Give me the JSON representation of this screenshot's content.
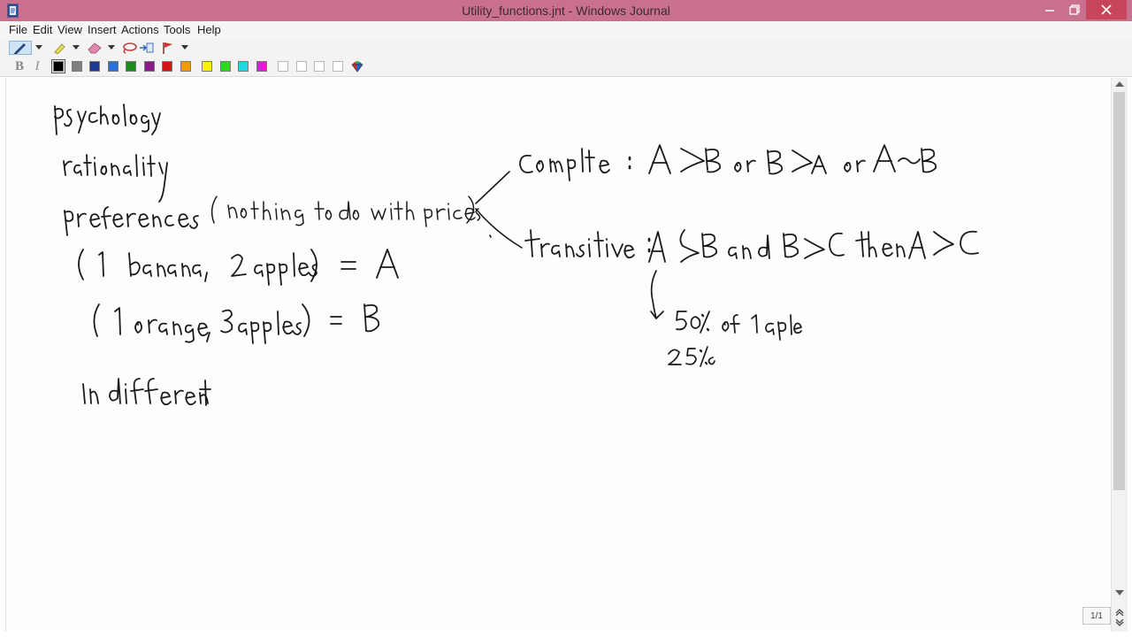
{
  "window": {
    "title": "Utility_functions.jnt - Windows Journal",
    "controls": [
      "minimize-icon",
      "restore-icon",
      "close-icon"
    ]
  },
  "menu": {
    "items": [
      "File",
      "Edit",
      "View",
      "Insert",
      "Actions",
      "Tools",
      "Help"
    ]
  },
  "toolbar": {
    "tools": [
      "pen-icon",
      "dropdown-arrow-icon",
      "highlighter-icon",
      "dropdown-arrow-icon",
      "eraser-icon",
      "dropdown-arrow-icon",
      "lasso-icon",
      "insert-space-icon",
      "flag-icon",
      "dropdown-arrow-icon"
    ],
    "bold_label": "B",
    "italic_label": "I",
    "pen_colors": [
      "#000000",
      "#7f7f7f",
      "#1f3a93",
      "#2a6fd6",
      "#1a8c1a",
      "#8b1a8b",
      "#d41515",
      "#f59a0a",
      "#f7f200",
      "#22e01d",
      "#21d6e3",
      "#e61ad6"
    ],
    "empty_swatches": 4,
    "color_picker": "color-wheel-icon"
  },
  "note": {
    "handwriting": [
      "psychology",
      "rationality",
      "preferences",
      "(nothing to do with prices)",
      "(1 banana, 2 apples) = A",
      "(1 orange, 3 apples) = B",
      "Indifferent",
      "Complete : A ≻ B or B ≻ A or A ~ B",
      "transitive : A ≻ B and B ≻ C then A ≻ C",
      "50% of 1 apple",
      "25%"
    ]
  },
  "page_indicator": "1/1"
}
